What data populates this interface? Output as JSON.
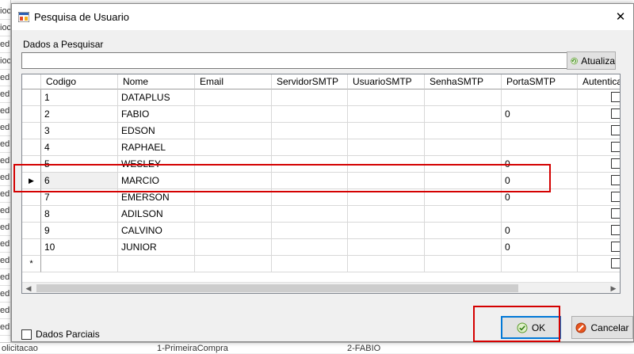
{
  "background": {
    "left_rows": [
      "ioc",
      "ioc",
      "edi",
      "ioc",
      "edi",
      "edi",
      "edi",
      "edi",
      "edi",
      "edi",
      "edi",
      "edi",
      "edi",
      "edi",
      "edi",
      "edi",
      "edi",
      "edi",
      "edi",
      "edi"
    ],
    "bottom_row": [
      "olicitacao",
      "1-PrimeiraCompra",
      "2-FABIO"
    ]
  },
  "dialog": {
    "title": "Pesquisa de Usuario",
    "close_glyph": "✕"
  },
  "search": {
    "label": "Dados a Pesquisar",
    "value": "",
    "refresh_label": "Atualiza"
  },
  "grid": {
    "columns": [
      "Codigo",
      "Nome",
      "Email",
      "ServidorSMTP",
      "UsuarioSMTP",
      "SenhaSMTP",
      "PortaSMTP",
      "Autenticacao"
    ],
    "rows": [
      {
        "codigo": "1",
        "nome": "DATAPLUS",
        "porta": ""
      },
      {
        "codigo": "2",
        "nome": "FABIO",
        "porta": "0"
      },
      {
        "codigo": "3",
        "nome": "EDSON",
        "porta": ""
      },
      {
        "codigo": "4",
        "nome": "RAPHAEL",
        "porta": ""
      },
      {
        "codigo": "5",
        "nome": "WESLEY",
        "porta": "0"
      },
      {
        "codigo": "6",
        "nome": "MARCIO",
        "porta": "0"
      },
      {
        "codigo": "7",
        "nome": "EMERSON",
        "porta": "0"
      },
      {
        "codigo": "8",
        "nome": "ADILSON",
        "porta": ""
      },
      {
        "codigo": "9",
        "nome": "CALVINO",
        "porta": "0"
      },
      {
        "codigo": "10",
        "nome": "JUNIOR",
        "porta": "0"
      }
    ],
    "selected_index": 5,
    "current_row_glyph": "▶",
    "new_row_glyph": "*"
  },
  "footer": {
    "partial_label": "Dados Parciais",
    "ok_label": "OK",
    "cancel_label": "Cancelar"
  },
  "colors": {
    "highlight": "#d40000",
    "focus": "#0078d7"
  }
}
